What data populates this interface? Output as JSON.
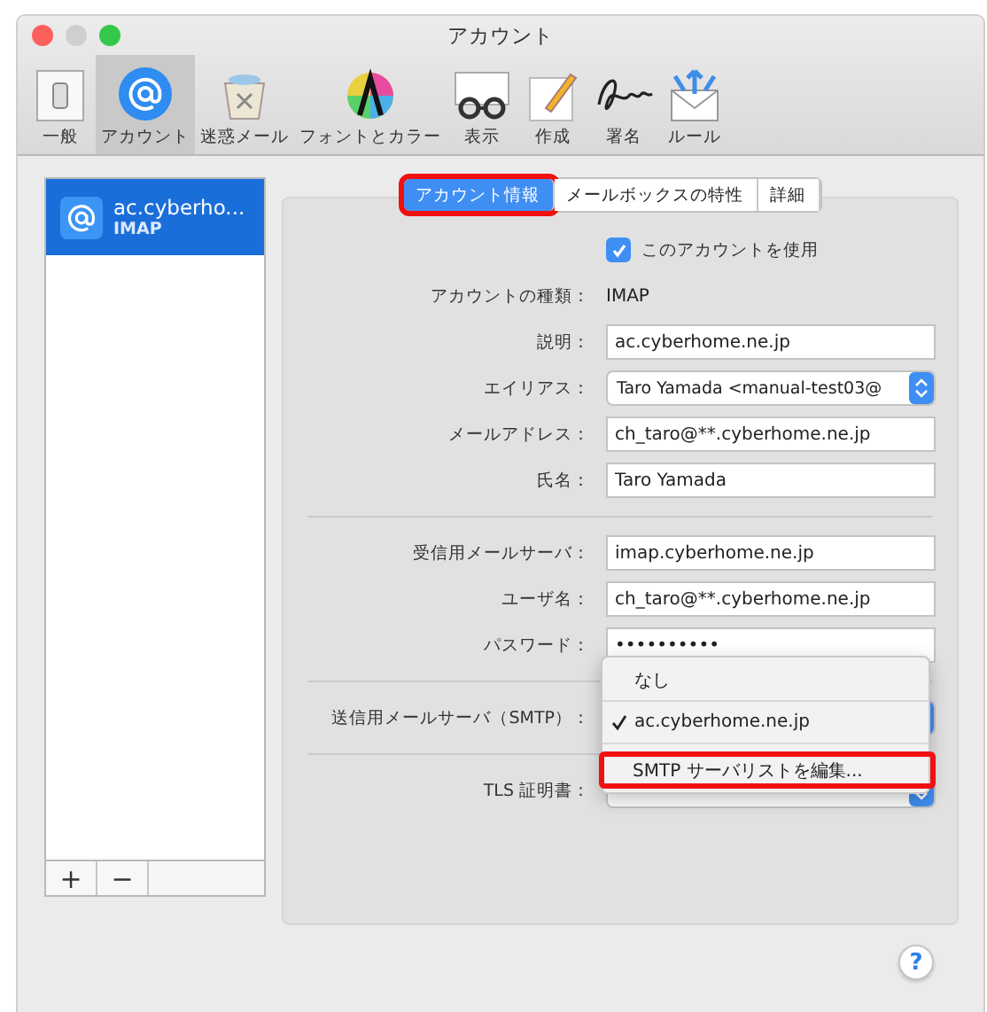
{
  "window": {
    "title": "アカウント"
  },
  "toolbar": [
    {
      "label": "一般",
      "selected": false
    },
    {
      "label": "アカウント",
      "selected": true
    },
    {
      "label": "迷惑メール",
      "selected": false
    },
    {
      "label": "フォントとカラー",
      "selected": false
    },
    {
      "label": "表示",
      "selected": false
    },
    {
      "label": "作成",
      "selected": false
    },
    {
      "label": "署名",
      "selected": false
    },
    {
      "label": "ルール",
      "selected": false
    }
  ],
  "accounts": [
    {
      "name": "ac.cyberho...",
      "type": "IMAP",
      "selected": true
    }
  ],
  "list_buttons": [
    "+",
    "−"
  ],
  "tabs": [
    {
      "label": "アカウント情報",
      "selected": true,
      "highlighted": true
    },
    {
      "label": "メールボックスの特性",
      "selected": false,
      "highlighted": false
    },
    {
      "label": "詳細",
      "selected": false,
      "highlighted": false
    }
  ],
  "form": [
    {
      "kind": "checkbox",
      "label": "このアカウントを使用",
      "checked": true
    },
    {
      "kind": "static",
      "label": "アカウントの種類：",
      "value": "IMAP"
    },
    {
      "kind": "field",
      "label": "説明：",
      "value": "ac.cyberhome.ne.jp"
    },
    {
      "kind": "select",
      "label": "エイリアス：",
      "value": "Taro Yamada <manual-test03@"
    },
    {
      "kind": "field",
      "label": "メールアドレス：",
      "value": "ch_taro@**.cyberhome.ne.jp"
    },
    {
      "kind": "field",
      "label": "氏名：",
      "value": "Taro Yamada"
    },
    {
      "kind": "divider"
    },
    {
      "kind": "field",
      "label": "受信用メールサーバ：",
      "value": "imap.cyberhome.ne.jp"
    },
    {
      "kind": "field",
      "label": "ユーザ名：",
      "value": "ch_taro@**.cyberhome.ne.jp"
    },
    {
      "kind": "password",
      "label": "パスワード：",
      "value": "••••••••••"
    },
    {
      "kind": "divider"
    },
    {
      "kind": "select",
      "label": "送信用メールサーバ（SMTP）："
    },
    {
      "kind": "divider"
    },
    {
      "kind": "select",
      "label": "TLS 証明書："
    }
  ],
  "popup_menu": [
    {
      "label": "なし",
      "checked": false,
      "highlighted": false
    },
    {
      "label": "ac.cyberhome.ne.jp",
      "checked": true,
      "highlighted": false
    },
    {
      "label": "SMTP サーバリストを編集...",
      "checked": false,
      "highlighted": true
    }
  ],
  "help_button": "?"
}
